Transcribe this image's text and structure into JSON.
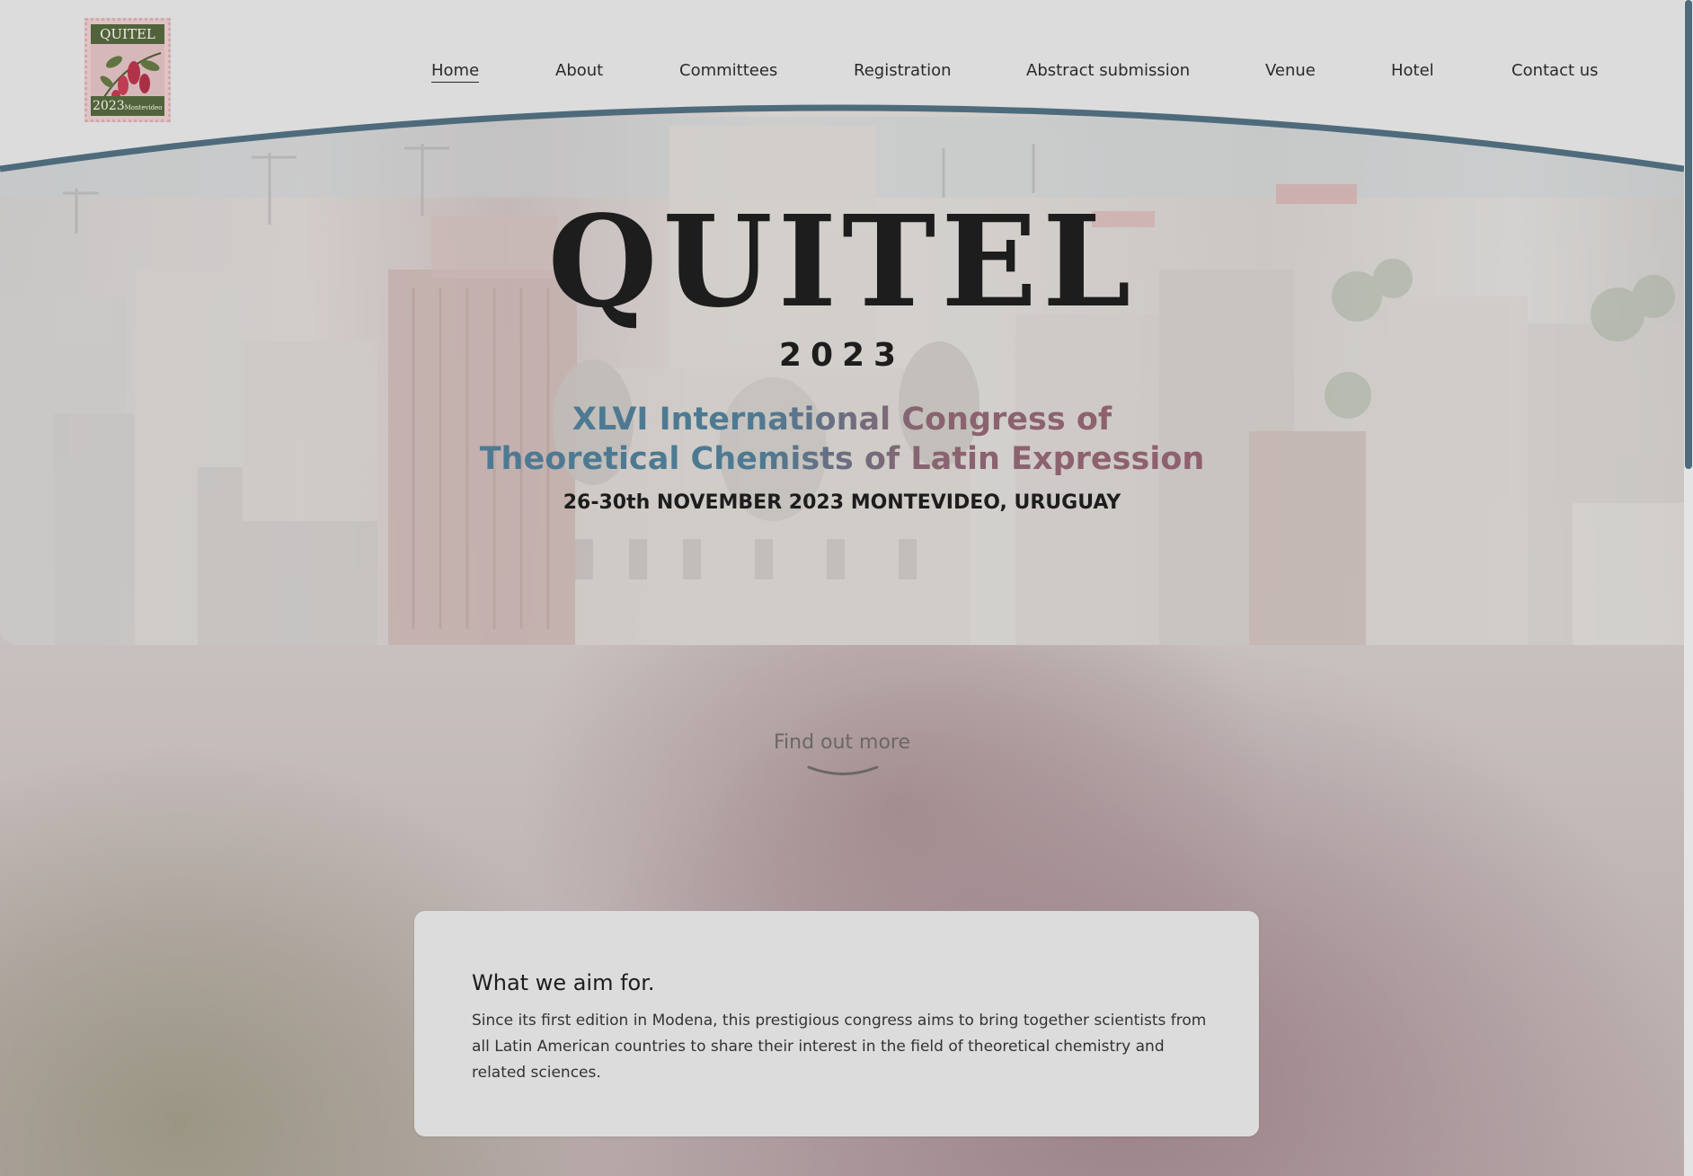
{
  "logo": {
    "top_text": "QUITEL",
    "year": "2023",
    "city": "Montevideo"
  },
  "nav": {
    "items": [
      {
        "label": "Home",
        "active": true
      },
      {
        "label": "About",
        "active": false
      },
      {
        "label": "Committees",
        "active": false
      },
      {
        "label": "Registration",
        "active": false
      },
      {
        "label": "Abstract submission",
        "active": false
      },
      {
        "label": "Venue",
        "active": false
      },
      {
        "label": "Hotel",
        "active": false
      },
      {
        "label": "Contact us",
        "active": false
      }
    ]
  },
  "hero": {
    "title": "QUITEL",
    "year": "2023",
    "subtitle_line1": "XLVI International Congress of",
    "subtitle_line2": "Theoretical Chemists of Latin Expression",
    "date": "26-30th NOVEMBER 2023 MONTEVIDEO, URUGUAY"
  },
  "find_more": {
    "label": "Find out more"
  },
  "aim_card": {
    "title": "What we aim for.",
    "body": "Since its first edition in Modena, this prestigious congress aims to bring together scientists from all Latin American countries to share their interest in the field of theoretical chemistry and related sciences."
  },
  "colors": {
    "accent": "#4e6b7c",
    "subtitle_blue": "#4d7a92",
    "subtitle_rose": "#9a5a69",
    "logo_green": "#51633b"
  }
}
